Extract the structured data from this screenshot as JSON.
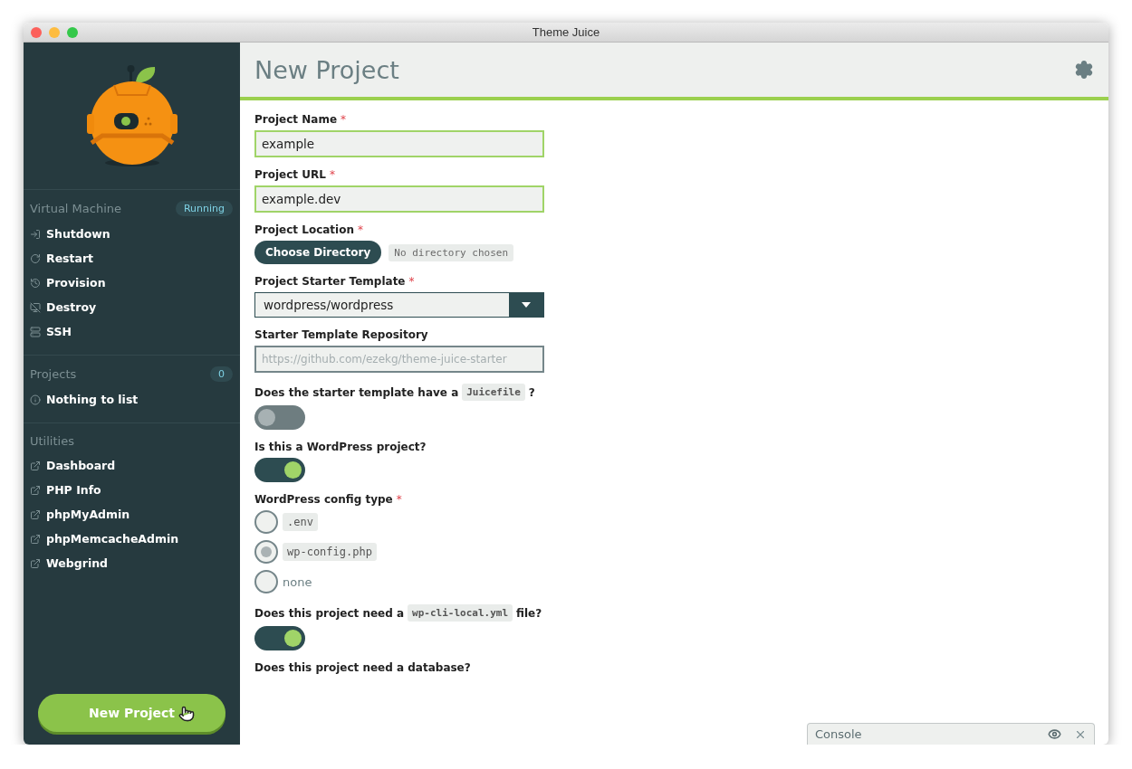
{
  "window": {
    "title": "Theme Juice"
  },
  "sidebar": {
    "sections": [
      {
        "kind": "vm",
        "title": "Virtual Machine",
        "badge": "Running",
        "items": [
          {
            "label": "Shutdown"
          },
          {
            "label": "Restart"
          },
          {
            "label": "Provision"
          },
          {
            "label": "Destroy"
          },
          {
            "label": "SSH"
          }
        ]
      },
      {
        "kind": "projects",
        "title": "Projects",
        "badge": "0",
        "items": [
          {
            "label": "Nothing to list"
          }
        ]
      },
      {
        "kind": "utilities",
        "title": "Utilities",
        "items": [
          {
            "label": "Dashboard"
          },
          {
            "label": "PHP Info"
          },
          {
            "label": "phpMyAdmin"
          },
          {
            "label": "phpMemcacheAdmin"
          },
          {
            "label": "Webgrind"
          }
        ]
      }
    ],
    "new_project_button": "New Project"
  },
  "header": {
    "title": "New Project"
  },
  "form": {
    "fields": [
      {
        "kind": "text",
        "label": [
          {
            "kind": "text",
            "text": "Project Name"
          }
        ],
        "required_mark": "*",
        "value": "example"
      },
      {
        "kind": "text",
        "label": [
          {
            "kind": "text",
            "text": "Project URL"
          }
        ],
        "required_mark": "*",
        "value": "example.dev"
      },
      {
        "kind": "file",
        "label": [
          {
            "kind": "text",
            "text": "Project Location"
          }
        ],
        "required_mark": "*",
        "button": "Choose Directory",
        "status": "No directory chosen"
      },
      {
        "kind": "select",
        "label": [
          {
            "kind": "text",
            "text": "Project Starter Template"
          }
        ],
        "required_mark": "*",
        "value": "wordpress/wordpress"
      },
      {
        "kind": "text",
        "label": [
          {
            "kind": "text",
            "text": "Starter Template Repository"
          }
        ],
        "placeholder": "https://github.com/ezekg/theme-juice-starter"
      },
      {
        "kind": "toggle",
        "label": [
          {
            "kind": "text",
            "text": "Does the starter template have a"
          },
          {
            "kind": "code",
            "text": "Juicefile"
          },
          {
            "kind": "text",
            "text": "?"
          }
        ],
        "on": false
      },
      {
        "kind": "toggle",
        "label": [
          {
            "kind": "text",
            "text": "Is this a WordPress project?"
          }
        ],
        "on": true
      },
      {
        "kind": "radio",
        "label": [
          {
            "kind": "text",
            "text": "WordPress config type"
          }
        ],
        "required_mark": "*",
        "options": [
          {
            "label": ".env",
            "kind": "code",
            "selected": false
          },
          {
            "label": "wp-config.php",
            "kind": "code",
            "selected": true
          },
          {
            "label": "none",
            "kind": "plain",
            "selected": false
          }
        ]
      },
      {
        "kind": "toggle",
        "label": [
          {
            "kind": "text",
            "text": "Does this project need a"
          },
          {
            "kind": "code",
            "text": "wp-cli-local.yml"
          },
          {
            "kind": "text",
            "text": "file?"
          }
        ],
        "on": true
      },
      {
        "kind": "heading",
        "label": [
          {
            "kind": "text",
            "text": "Does this project need a database?"
          }
        ]
      }
    ]
  },
  "console": {
    "title": "Console"
  }
}
